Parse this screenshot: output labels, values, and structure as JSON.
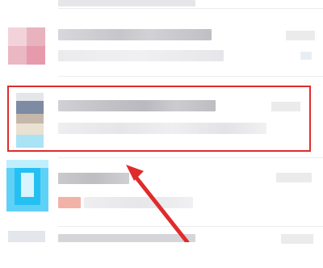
{
  "conversation_list": {
    "rows": [
      {
        "row_index": 0,
        "blurred": true
      },
      {
        "row_index": 1,
        "blurred": true
      },
      {
        "row_index": 2,
        "blurred": true,
        "highlighted": true
      },
      {
        "row_index": 3,
        "blurred": true
      },
      {
        "row_index": 4,
        "blurred": true
      }
    ]
  },
  "annotation": {
    "highlight_color": "#e02b2b",
    "arrow_color": "#e02b2b",
    "arrow_target": "row_3"
  },
  "colors": {
    "background": "#ffffff",
    "avatar_pink": "#e8a9b6",
    "avatar_cyan": "#25c0f2",
    "blur_gray": "#cfcfcf",
    "accent_red_bar": "#f3b2a8"
  }
}
